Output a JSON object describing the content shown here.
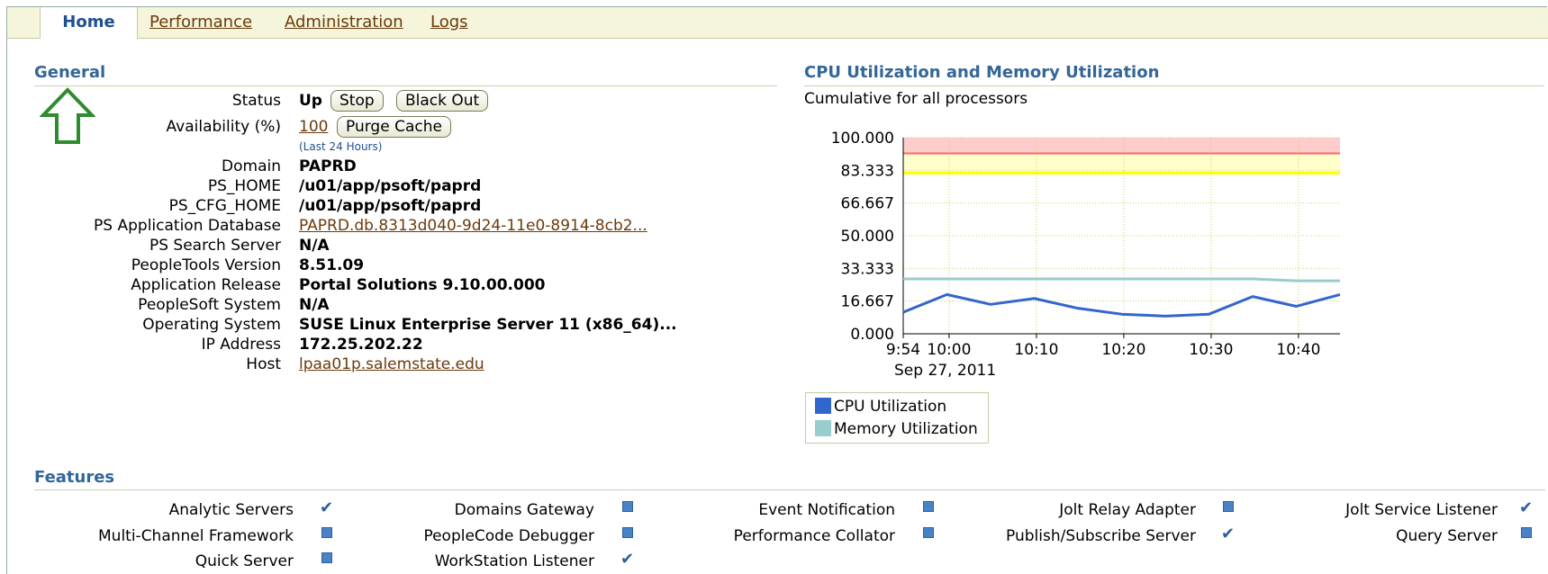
{
  "tabs": [
    {
      "label": "Home",
      "active": true
    },
    {
      "label": "Performance"
    },
    {
      "label": "Administration"
    },
    {
      "label": "Logs"
    }
  ],
  "general": {
    "title": "General",
    "status_label": "Status",
    "status_value": "Up",
    "stop_button": "Stop",
    "blackout_button": "Black Out",
    "availability_label": "Availability (%)",
    "availability_value": "100",
    "purge_button": "Purge Cache",
    "availability_note": "(Last 24 Hours)",
    "rows": [
      {
        "label": "Domain",
        "value": "PAPRD"
      },
      {
        "label": "PS_HOME",
        "value": "/u01/app/psoft/paprd"
      },
      {
        "label": "PS_CFG_HOME",
        "value": "/u01/app/psoft/paprd"
      },
      {
        "label": "PS Application Database",
        "value": "PAPRD.db.8313d040-9d24-11e0-8914-8cb2...",
        "link": true
      },
      {
        "label": "PS Search Server",
        "value": "N/A"
      },
      {
        "label": "PeopleTools Version",
        "value": "8.51.09"
      },
      {
        "label": "Application Release",
        "value": "Portal Solutions 9.10.00.000"
      },
      {
        "label": "PeopleSoft System",
        "value": "N/A"
      },
      {
        "label": "Operating System",
        "value": "SUSE Linux Enterprise Server 11 (x86_64)..."
      },
      {
        "label": "IP Address",
        "value": "172.25.202.22"
      },
      {
        "label": "Host",
        "value": "lpaa01p.salemstate.edu",
        "link": true
      }
    ]
  },
  "cpu": {
    "title": "CPU Utilization and Memory Utilization",
    "subtitle": "Cumulative for all processors"
  },
  "chart_data": {
    "type": "line",
    "x": [
      "9:54",
      "9:58",
      "10:03",
      "10:08",
      "10:13",
      "10:18",
      "10:23",
      "10:28",
      "10:33",
      "10:38",
      "10:43"
    ],
    "xticks": [
      "9:54",
      "10:00",
      "10:10",
      "10:20",
      "10:30",
      "10:40"
    ],
    "xdate": "Sep 27, 2011",
    "yticks": [
      "100.000",
      "83.333",
      "66.667",
      "50.000",
      "33.333",
      "16.667",
      "0.000"
    ],
    "ylim": [
      0,
      100
    ],
    "thresholds": {
      "critical": 92,
      "warning": 82
    },
    "series": [
      {
        "name": "CPU Utilization",
        "color": "#3366cc",
        "values": [
          11,
          20,
          15,
          18,
          13,
          10,
          9,
          10,
          19,
          14,
          20
        ]
      },
      {
        "name": "Memory Utilization",
        "color": "#99cccc",
        "values": [
          28,
          28,
          28,
          28,
          28,
          28,
          28,
          28,
          28,
          27,
          27
        ]
      }
    ],
    "colors": {
      "critical_band": "#ffcccc",
      "critical_line": "#ff6666",
      "warning_band": "#ffffcc",
      "warning_line": "#ffff00",
      "grid": "#cccc66"
    }
  },
  "features": {
    "title": "Features",
    "items": [
      {
        "label": "Analytic Servers",
        "on": true
      },
      {
        "label": "Domains Gateway",
        "on": false
      },
      {
        "label": "Event Notification",
        "on": false
      },
      {
        "label": "Jolt Relay Adapter",
        "on": false
      },
      {
        "label": "Jolt Service Listener",
        "on": true
      },
      {
        "label": "Multi-Channel Framework",
        "on": false
      },
      {
        "label": "PeopleCode Debugger",
        "on": false
      },
      {
        "label": "Performance Collator",
        "on": false
      },
      {
        "label": "Publish/Subscribe Server",
        "on": true
      },
      {
        "label": "Query Server",
        "on": false
      },
      {
        "label": "Quick Server",
        "on": false
      },
      {
        "label": "WorkStation Listener",
        "on": true
      }
    ]
  }
}
